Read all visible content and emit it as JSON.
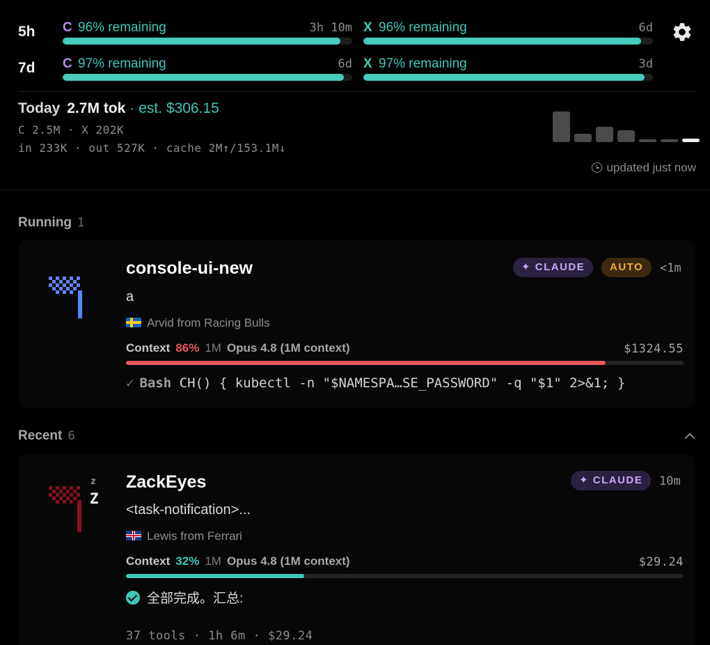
{
  "limits": {
    "rows": [
      {
        "period": "5h",
        "claude": {
          "prefix": "C",
          "text": "96% remaining",
          "reset": "3h 10m",
          "fraction": 0.96
        },
        "codex": {
          "prefix": "X",
          "text": "96% remaining",
          "reset": "6d",
          "fraction": 0.96
        }
      },
      {
        "period": "7d",
        "claude": {
          "prefix": "C",
          "text": "97% remaining",
          "reset": "6d",
          "fraction": 0.97
        },
        "codex": {
          "prefix": "X",
          "text": "97% remaining",
          "reset": "3d",
          "fraction": 0.97
        }
      }
    ],
    "settings_icon": "gear-icon"
  },
  "today": {
    "label": "Today",
    "tokens": "2.7M tok",
    "estimate": "· est. $306.15",
    "breakdown": "C 2.5M · X 202K",
    "io": "in 233K · out 527K · cache 2M↑/153.1M↓",
    "history_levels": [
      1.0,
      0.27,
      0.51,
      0.38,
      0.1,
      0.1,
      0.12
    ],
    "updated": "updated just now",
    "updated_icon": "clock-icon"
  },
  "running": {
    "title": "Running",
    "count": "1",
    "session": {
      "name": "console-ui-new",
      "prompt": "a",
      "agent": "Arvid from Racing Bulls",
      "flag": "sweden-flag",
      "provider": "✦ CLAUDE",
      "mode": "AUTO",
      "age": "<1m",
      "context_label": "Context",
      "context_pct": "86%",
      "context_fraction": 0.86,
      "context_size": "1M",
      "model": "Opus 4.8 (1M context)",
      "cost": "$1324.55",
      "last_tool_check": "✓",
      "last_tool": "Bash",
      "last_command": "CH() { kubectl -n \"$NAMESPA…SE_PASSWORD\" -q \"$1\" 2>&1; }",
      "colors": {
        "context": "#e8585a",
        "icon": "#5b86f5"
      }
    }
  },
  "recent": {
    "title": "Recent",
    "count": "6",
    "collapse_icon": "chevron-up-icon",
    "session": {
      "name": "ZackEyes",
      "prompt": "<task-notification>...",
      "agent": "Lewis from Ferrari",
      "flag": "uk-flag",
      "provider": "✦ CLAUDE",
      "age": "10m",
      "context_label": "Context",
      "context_pct": "32%",
      "context_fraction": 0.32,
      "context_size": "1M",
      "model": "Opus 4.8 (1M context)",
      "cost": "$29.24",
      "result": "全部完成。汇总:",
      "stats": "37 tools · 1h 6m · $29.24",
      "sleep_small": "z",
      "sleep_big": "Z",
      "colors": {
        "context": "#3fc7b8",
        "icon": "#8a1020"
      }
    }
  }
}
